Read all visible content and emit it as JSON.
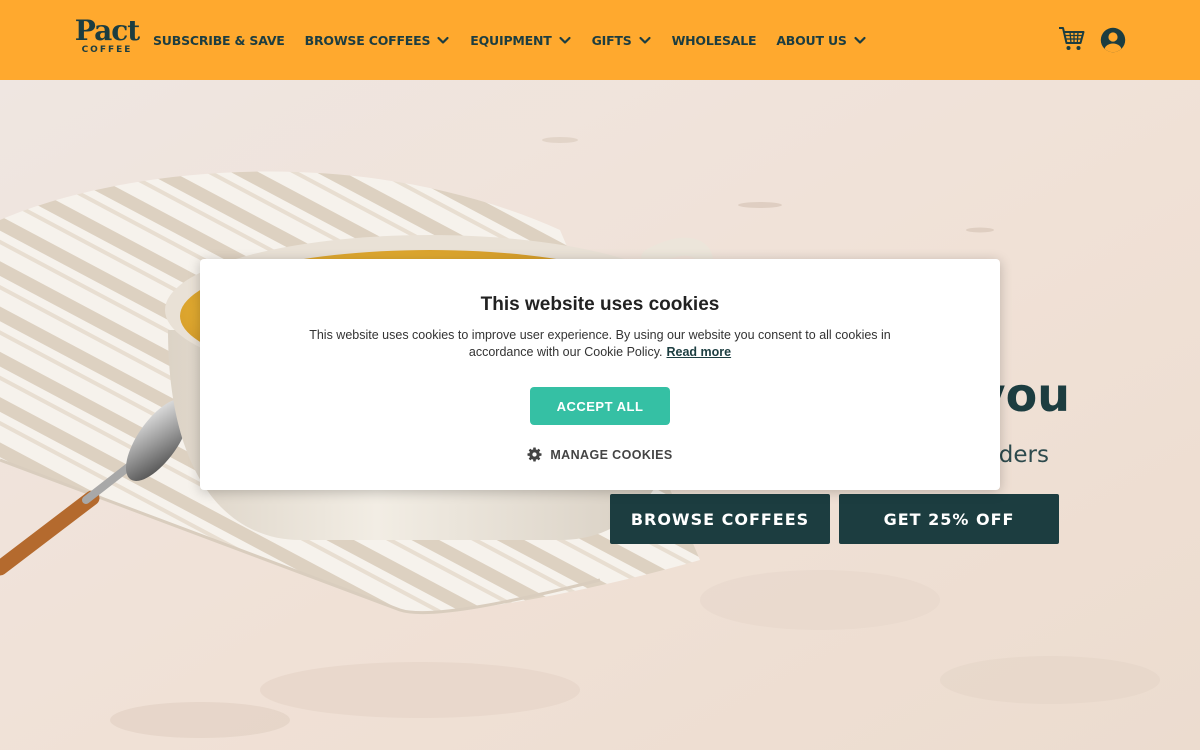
{
  "brand": {
    "name": "Pact",
    "tagline": "COFFEE"
  },
  "nav": {
    "items": [
      {
        "label": "SUBSCRIBE & SAVE",
        "dropdown": false
      },
      {
        "label": "BROWSE COFFEES",
        "dropdown": true
      },
      {
        "label": "EQUIPMENT",
        "dropdown": true
      },
      {
        "label": "GIFTS",
        "dropdown": true
      },
      {
        "label": "WHOLESALE",
        "dropdown": false
      },
      {
        "label": "ABOUT US",
        "dropdown": true
      }
    ]
  },
  "icons": {
    "cart": "cart-icon",
    "account": "account-icon",
    "chevron": "chevron-down-icon",
    "gear": "gear-icon"
  },
  "hero": {
    "heading_visible": "you",
    "subheading_visible": "rders",
    "buttons": {
      "browse": "BROWSE COFFEES",
      "offer": "GET 25% OFF"
    }
  },
  "cookie": {
    "title": "This website uses cookies",
    "text": "This website uses cookies to improve user experience. By using our website you consent to all cookies in accordance with our Cookie Policy.",
    "link": "Read more",
    "accept": "ACCEPT ALL",
    "manage": "MANAGE COOKIES"
  },
  "colors": {
    "header": "#ffa92e",
    "primary": "#1c3d40",
    "accept": "#35c0a4",
    "background": "#f1e8e2"
  }
}
